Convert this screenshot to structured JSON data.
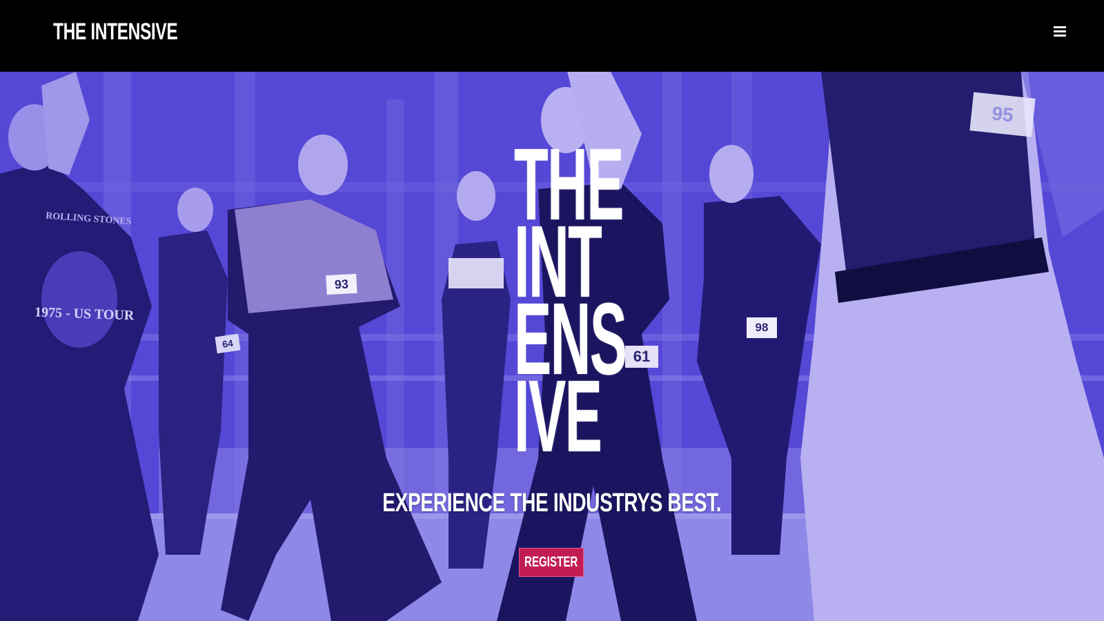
{
  "header": {
    "brand": "THE INTENSIVE",
    "menu_icon": "hamburger-menu-icon"
  },
  "hero": {
    "title_lines": [
      "THE",
      "INT",
      "ENS",
      "IVE"
    ],
    "tagline": "EXPERIENCE THE INDUSTRYS BEST.",
    "register_label": "REGISTER",
    "bib_numbers": [
      "93",
      "64",
      "61",
      "98",
      "95"
    ],
    "shirt_text": {
      "band": "ROLLING STONES",
      "tour": "1975 - US TOUR"
    }
  },
  "colors": {
    "header_bg": "#000000",
    "hero_tint": "#4c3fcf",
    "register_bg": "#c21c54",
    "text": "#ffffff"
  }
}
